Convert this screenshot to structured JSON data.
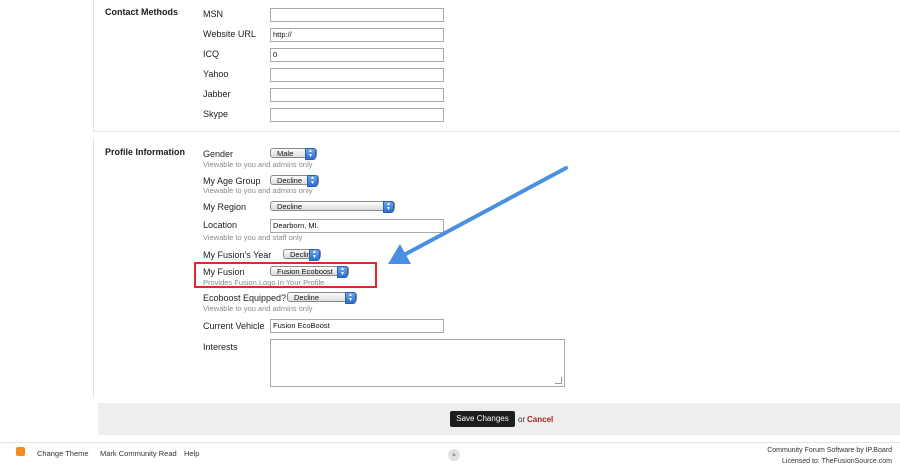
{
  "contact": {
    "section_label": "Contact Methods",
    "fields": [
      {
        "label": "MSN",
        "value": ""
      },
      {
        "label": "Website URL",
        "value": "http://"
      },
      {
        "label": "ICQ",
        "value": "0"
      },
      {
        "label": "Yahoo",
        "value": ""
      },
      {
        "label": "Jabber",
        "value": ""
      },
      {
        "label": "Skype",
        "value": ""
      }
    ]
  },
  "profile": {
    "section_label": "Profile Information",
    "gender": {
      "label": "Gender",
      "value": "Male",
      "desc": "Viewable to you and admins only"
    },
    "age_group": {
      "label": "My Age Group",
      "value": "Decline",
      "desc": "Viewable to you and admins only"
    },
    "region": {
      "label": "My Region",
      "value": "Decline"
    },
    "location": {
      "label": "Location",
      "value": "Dearborn, MI.",
      "desc": "Viewable to you and staff only"
    },
    "fusion_year": {
      "label": "My Fusion's Year",
      "value": "Decline"
    },
    "my_fusion": {
      "label": "My Fusion",
      "value": "Fusion Ecoboost",
      "desc": "Provides Fusion Logo In Your Profile"
    },
    "ecoboost": {
      "label": "Ecoboost Equipped?",
      "value": "Decline",
      "desc": "Viewable to you and admins only"
    },
    "current_vehicle": {
      "label": "Current Vehicle",
      "value": "Fusion EcoBoost"
    },
    "interests": {
      "label": "Interests",
      "value": ""
    }
  },
  "actions": {
    "save_label": "Save Changes",
    "or_text": "or",
    "cancel_label": "Cancel"
  },
  "footer": {
    "links": [
      "Change Theme",
      "Mark Community Read",
      "Help"
    ],
    "credit_line1": "Community Forum Software by IP.Board",
    "credit_line2": "Licensed to: TheFusionSource.com"
  },
  "colors": {
    "highlight": "#e1282d",
    "arrow": "#4a90e2",
    "cancel": "#a42424"
  },
  "icons": {
    "rss": "rss-icon",
    "back_to_top": "back-to-top-icon",
    "annotation_arrow": "annotation-arrow"
  }
}
